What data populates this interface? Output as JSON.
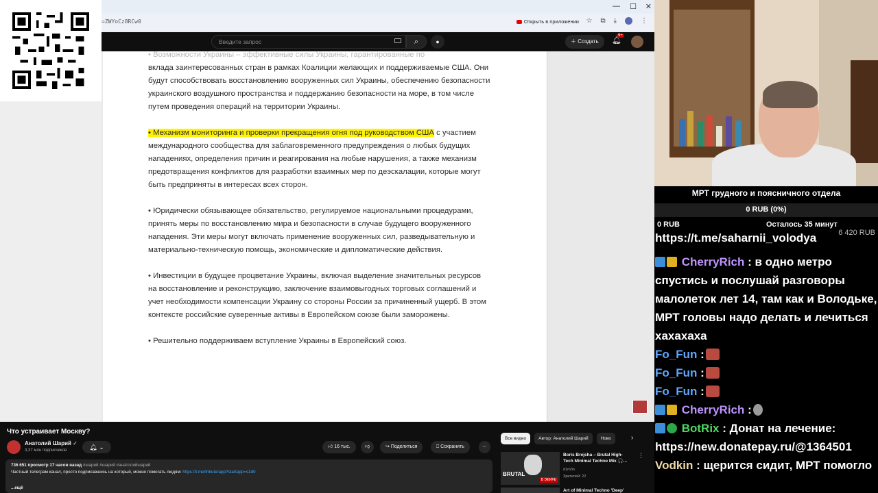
{
  "browser": {
    "window_controls": [
      "—",
      "☐",
      "✕"
    ],
    "url_fragment": "=ZWYoCz8RCw0",
    "open_in_app": "Открыть в приложении"
  },
  "youtube": {
    "search_placeholder": "Введите запрос",
    "create_label": "Создать",
    "notifications_badge": "9+",
    "video_title": "Что устраивает Москву?",
    "channel_name": "Анатолий Шарий",
    "subscribers": "3,37 млн подписчиков",
    "likes": "16 тыс.",
    "share_label": "Поделиться",
    "save_label": "Сохранить",
    "views_line": "736 651 просмотр  17 часов назад",
    "tags": "#шарий #шарий #анатолийшарий",
    "description": "Частный телеграм канал, просто подписавшись на который, можно помогать людям:",
    "description_link": "https://t.me/tribute/app?startapp=s1d0",
    "more": "...ещё",
    "chips": [
      "Все видео",
      "Автор: Анатолий Шарий",
      "Ново"
    ],
    "rec": {
      "title": "Boris Brejcha – Brutal High-Tech Minimal Techno Mix 🎧...",
      "author": "d1m0n",
      "viewers": "Зрителей: 22",
      "thumb_label": "BRUTAL",
      "live_label": "В ЭФИРЕ",
      "title2": "Art of Minimal Techno 'Deep'"
    }
  },
  "document": {
    "cutoff_line": "• Возможности Украины – эффективные силы Украины, гарантированные по",
    "p1": "вклада заинтересованных стран в рамках Коалиции желающих и поддерживаемые США. Они будут способствовать восстановлению вооруженных сил Украины, обеспечению безопасности украинского воздушного пространства и поддержанию безопасности на море, в том числе путем проведения операций на территории Украины.",
    "p2_highlight": "• Механизм мониторинга и проверки прекращения огня под руководством США",
    "p2_rest": " с участием международного сообщества для заблаговременного предупреждения о любых будущих нападениях, определения причин и реагирования на любые нарушения, а также механизм предотвращения конфликтов для разработки взаимных мер по деэскалации, которые могут быть предприняты в интересах всех сторон.",
    "p3": "• Юридически обязывающее обязательство, регулируемое национальными процедурами, принять меры по восстановлению мира и безопасности в случае будущего вооруженного нападения. Эти меры могут включать применение вооруженных сил, разведывательную и материально-техническую помощь, экономические и дипломатические действия.",
    "p4": "• Инвестиции в будущее процветание Украины, включая выделение значительных ресурсов на восстановление и реконструкцию, заключение взаимовыгодных торговых соглашений и учет необходимости компенсации Украину со стороны России за причиненный ущерб. В этом контексте российские суверенные активы в Европейском союзе были заморожены.",
    "p5": "• Решительно поддерживаем вступление Украины в Европейский союз."
  },
  "stream": {
    "goal_title": "МРТ грудного и поясничного отдела",
    "goal_current": "0 RUB (0%)",
    "goal_progress": 0,
    "goal_min": "0 RUB",
    "goal_time_left": "Осталось 35 минут",
    "goal_max": "6 420 RUB",
    "pinned_link": "https://t.me/saharnii_volodya",
    "chat": [
      {
        "user": "CherryRich",
        "sep": ":",
        "text": " в одно метро спустись и послушай разговоры малолеток лет 14, там как и Володьке, МРТ головы надо делать и лечиться хахахаха"
      },
      {
        "user": "Fo_Fun",
        "sep": ":",
        "text": ""
      },
      {
        "user": "Fo_Fun",
        "sep": ":",
        "text": ""
      },
      {
        "user": "Fo_Fun",
        "sep": ":",
        "text": ""
      },
      {
        "user": "CherryRich",
        "sep": ":",
        "text": ""
      },
      {
        "user": "BotRix",
        "sep": ":",
        "text": " Донат на лечение: https://new.donatepay.ru/@1364501"
      },
      {
        "user": "Vodkin",
        "sep": ":",
        "text": " щерится сидит, МРТ помогло"
      }
    ],
    "colors": {
      "cherry": "#bf94ff",
      "fofun": "#5fa8ff",
      "botrix": "#4cd964",
      "vodkin": "#f0d9a8"
    }
  }
}
